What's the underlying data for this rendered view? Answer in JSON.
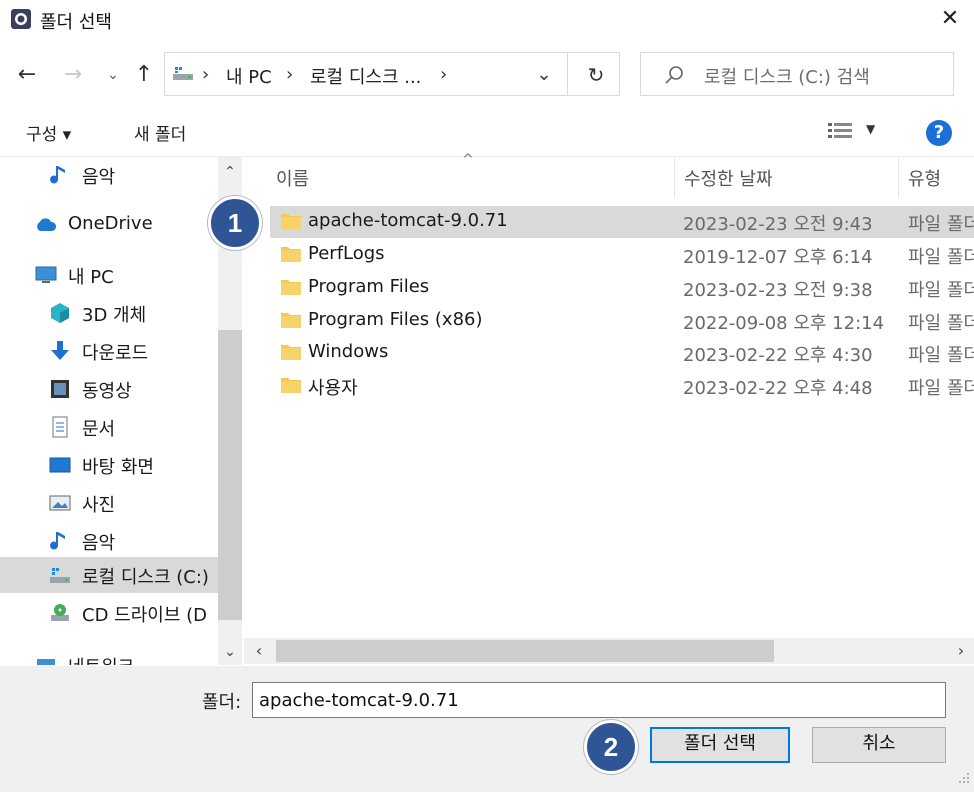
{
  "window": {
    "title": "폴더 선택",
    "close_glyph": "✕"
  },
  "nav": {
    "back_glyph": "←",
    "forward_glyph": "→",
    "recent_glyph": "⌄",
    "up_glyph": "↑",
    "breadcrumb": [
      "내 PC",
      "로컬 디스크 ..."
    ],
    "sep_glyph": "›",
    "dropdown_glyph": "⌄",
    "refresh_glyph": "↻",
    "search_placeholder": "로컬 디스크 (C:) 검색"
  },
  "toolbar": {
    "organize_label": "구성 ▾",
    "new_folder_label": "새 폴더",
    "view_arrow": "▼",
    "help_label": "?"
  },
  "sidebar": {
    "items": [
      {
        "label": "음악",
        "icon": "music-icon"
      },
      {
        "label": "OneDrive",
        "icon": "cloud-icon"
      },
      {
        "label": "내 PC",
        "icon": "computer-icon"
      },
      {
        "label": "3D 개체",
        "icon": "cube-icon"
      },
      {
        "label": "다운로드",
        "icon": "download-icon"
      },
      {
        "label": "동영상",
        "icon": "video-icon"
      },
      {
        "label": "문서",
        "icon": "document-icon"
      },
      {
        "label": "바탕 화면",
        "icon": "desktop-icon"
      },
      {
        "label": "사진",
        "icon": "picture-icon"
      },
      {
        "label": "음악",
        "icon": "music-icon"
      },
      {
        "label": "로컬 디스크 (C:)",
        "icon": "drive-icon"
      },
      {
        "label": "CD 드라이브 (D",
        "icon": "cd-drive-icon"
      },
      {
        "label": "네트워크",
        "icon": "network-icon"
      }
    ],
    "scroll_up": "⌃",
    "scroll_down": "⌄"
  },
  "list": {
    "columns": [
      "이름",
      "수정한 날짜",
      "유형"
    ],
    "sort_glyph": "^",
    "rows": [
      {
        "name": "apache-tomcat-9.0.71",
        "date": "2023-02-23 오전 9:43",
        "type": "파일 폴더"
      },
      {
        "name": "PerfLogs",
        "date": "2019-12-07 오후 6:14",
        "type": "파일 폴더"
      },
      {
        "name": "Program Files",
        "date": "2023-02-23 오전 9:38",
        "type": "파일 폴더"
      },
      {
        "name": "Program Files (x86)",
        "date": "2022-09-08 오후 12:14",
        "type": "파일 폴더"
      },
      {
        "name": "Windows",
        "date": "2023-02-22 오후 4:30",
        "type": "파일 폴더"
      },
      {
        "name": "사용자",
        "date": "2023-02-22 오후 4:48",
        "type": "파일 폴더"
      }
    ],
    "hscroll_left": "‹",
    "hscroll_right": "›"
  },
  "footer": {
    "folder_label": "폴더:",
    "folder_value": "apache-tomcat-9.0.71",
    "select_button": "폴더 선택",
    "cancel_button": "취소"
  },
  "badges": [
    "1",
    "2"
  ],
  "colors": {
    "accent": "#0078d7",
    "badge": "#2f5597",
    "selection": "#d9d9d9",
    "folder": "#f3c955"
  }
}
